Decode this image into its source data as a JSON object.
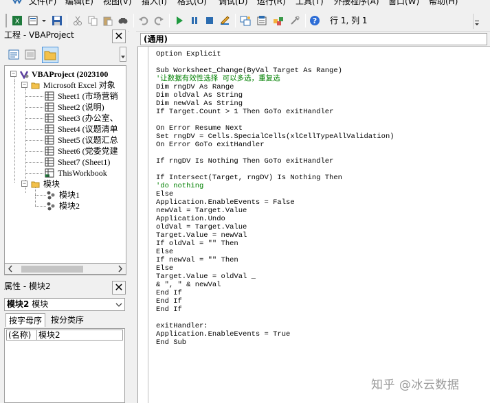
{
  "menubar": {
    "items": [
      "文件(F)",
      "编辑(E)",
      "视图(V)",
      "插入(I)",
      "格式(O)",
      "调试(D)",
      "运行(R)",
      "工具(T)",
      "外接程序(A)",
      "窗口(W)",
      "帮助(H)"
    ]
  },
  "toolbar": {
    "position_text": "行 1, 列 1",
    "icons": [
      "excel-icon",
      "insert-module-icon",
      "save-icon",
      "cut-icon",
      "copy-icon",
      "paste-icon",
      "find-icon",
      "undo-icon",
      "redo-icon",
      "run-icon",
      "break-icon",
      "reset-icon",
      "design-mode-icon",
      "project-explorer-icon",
      "properties-icon",
      "object-browser-icon",
      "toolbox-icon",
      "help-icon"
    ]
  },
  "project_pane": {
    "title": "工程 - VBAProject",
    "close": "✕",
    "root": "VBAProject (2023100",
    "objects_folder": "Microsoft Excel 对象",
    "sheets": [
      "Sheet1 (市场营销",
      "Sheet2 (说明)",
      "Sheet3 (办公室、",
      "Sheet4 (议题清单",
      "Sheet5 (议题汇总",
      "Sheet6 (党委党建",
      "Sheet7 (Sheet1)",
      "ThisWorkbook"
    ],
    "modules_folder": "模块",
    "modules": [
      "模块1",
      "模块2"
    ]
  },
  "properties_pane": {
    "title": "属性 - 模块2",
    "close": "✕",
    "object_name": "模块2",
    "object_type": "模块",
    "tabs": [
      "按字母序",
      "按分类序"
    ],
    "property_name": "(名称)",
    "property_value": "模块2"
  },
  "code_window": {
    "object_dropdown": "(通用)",
    "lines": [
      {
        "text": "Option Explicit",
        "type": "code"
      },
      {
        "text": "",
        "type": "code"
      },
      {
        "text": "Sub Worksheet_Change(ByVal Target As Range)",
        "type": "code"
      },
      {
        "text": "'让数据有效性选择 可以多选，重复选",
        "type": "comment"
      },
      {
        "text": "Dim rngDV As Range",
        "type": "code"
      },
      {
        "text": "Dim oldVal As String",
        "type": "code"
      },
      {
        "text": "Dim newVal As String",
        "type": "code"
      },
      {
        "text": "If Target.Count > 1 Then GoTo exitHandler",
        "type": "code"
      },
      {
        "text": "",
        "type": "code"
      },
      {
        "text": "On Error Resume Next",
        "type": "code"
      },
      {
        "text": "Set rngDV = Cells.SpecialCells(xlCellTypeAllValidation)",
        "type": "code"
      },
      {
        "text": "On Error GoTo exitHandler",
        "type": "code"
      },
      {
        "text": "",
        "type": "code"
      },
      {
        "text": "If rngDV Is Nothing Then GoTo exitHandler",
        "type": "code"
      },
      {
        "text": "",
        "type": "code"
      },
      {
        "text": "If Intersect(Target, rngDV) Is Nothing Then",
        "type": "code"
      },
      {
        "text": "'do nothing",
        "type": "comment"
      },
      {
        "text": "Else",
        "type": "code"
      },
      {
        "text": "Application.EnableEvents = False",
        "type": "code"
      },
      {
        "text": "newVal = Target.Value",
        "type": "code"
      },
      {
        "text": "Application.Undo",
        "type": "code"
      },
      {
        "text": "oldVal = Target.Value",
        "type": "code"
      },
      {
        "text": "Target.Value = newVal",
        "type": "code"
      },
      {
        "text": "If oldVal = \"\" Then",
        "type": "code"
      },
      {
        "text": "Else",
        "type": "code"
      },
      {
        "text": "If newVal = \"\" Then",
        "type": "code"
      },
      {
        "text": "Else",
        "type": "code"
      },
      {
        "text": "Target.Value = oldVal _",
        "type": "code"
      },
      {
        "text": "& \", \" & newVal",
        "type": "code"
      },
      {
        "text": "End If",
        "type": "code"
      },
      {
        "text": "End If",
        "type": "code"
      },
      {
        "text": "End If",
        "type": "code"
      },
      {
        "text": "",
        "type": "code"
      },
      {
        "text": "exitHandler:",
        "type": "code"
      },
      {
        "text": "Application.EnableEvents = True",
        "type": "code"
      },
      {
        "text": "End Sub",
        "type": "code"
      }
    ]
  },
  "watermark": "知乎 @冰云数据"
}
